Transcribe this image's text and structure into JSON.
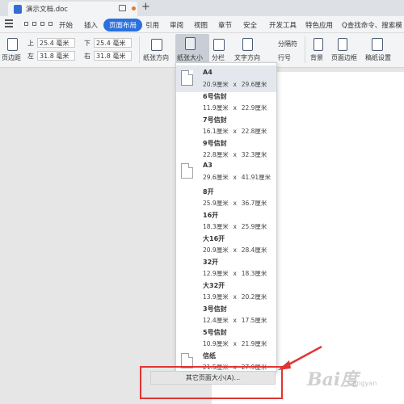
{
  "window": {
    "doc_title": "演示文档.doc",
    "new_tab": "+"
  },
  "menu": {
    "items": [
      "开始",
      "插入",
      "页面布局",
      "引用",
      "审阅",
      "视图",
      "章节",
      "安全",
      "开发工具",
      "特色应用"
    ],
    "active": "页面布局",
    "search_label": "Q查找命令、搜索模"
  },
  "ribbon": {
    "margins_label": "页边距",
    "margins": {
      "top_label": "上",
      "top_value": "25.4 毫米",
      "bottom_label": "下",
      "bottom_value": "25.4 毫米",
      "left_label": "左",
      "left_value": "31.8 毫米",
      "right_label": "右",
      "right_value": "31.8 毫米"
    },
    "orientation_label": "纸张方向",
    "size_label": "纸张大小",
    "columns_label": "分栏",
    "text_direction_label": "文字方向",
    "breaks_label": "分隔符",
    "line_numbers_label": "行号",
    "background_label": "背景",
    "page_border_label": "页面边框",
    "paper_setup_label": "稿纸设置"
  },
  "paper_sizes": [
    {
      "name": "A4",
      "width": "20.9厘米",
      "height": "29.6厘米",
      "selected": true,
      "icon": "paper-portrait-icon"
    },
    {
      "name": "6号信封",
      "width": "11.9厘米",
      "height": "22.9厘米",
      "selected": false
    },
    {
      "name": "7号信封",
      "width": "16.1厘米",
      "height": "22.8厘米",
      "selected": false
    },
    {
      "name": "9号信封",
      "width": "22.8厘米",
      "height": "32.3厘米",
      "selected": false
    },
    {
      "name": "A3",
      "width": "29.6厘米",
      "height": "41.91厘米",
      "selected": false,
      "icon": "paper-portrait-icon"
    },
    {
      "name": "8开",
      "width": "25.9厘米",
      "height": "36.7厘米",
      "selected": false
    },
    {
      "name": "16开",
      "width": "18.3厘米",
      "height": "25.9厘米",
      "selected": false
    },
    {
      "name": "大16开",
      "width": "20.9厘米",
      "height": "28.4厘米",
      "selected": false
    },
    {
      "name": "32开",
      "width": "12.9厘米",
      "height": "18.3厘米",
      "selected": false
    },
    {
      "name": "大32开",
      "width": "13.9厘米",
      "height": "20.2厘米",
      "selected": false
    },
    {
      "name": "3号信封",
      "width": "12.4厘米",
      "height": "17.5厘米",
      "selected": false
    },
    {
      "name": "5号信封",
      "width": "10.9厘米",
      "height": "21.9厘米",
      "selected": false
    },
    {
      "name": "信纸",
      "width": "21.5厘米",
      "height": "27.9厘米",
      "selected": false,
      "icon": "paper-portrait-icon"
    }
  ],
  "times_sign": "x",
  "other_sizes_label": "其它页面大小(A)...",
  "watermark": {
    "main": "Bai度",
    "sub": "jingyan"
  }
}
